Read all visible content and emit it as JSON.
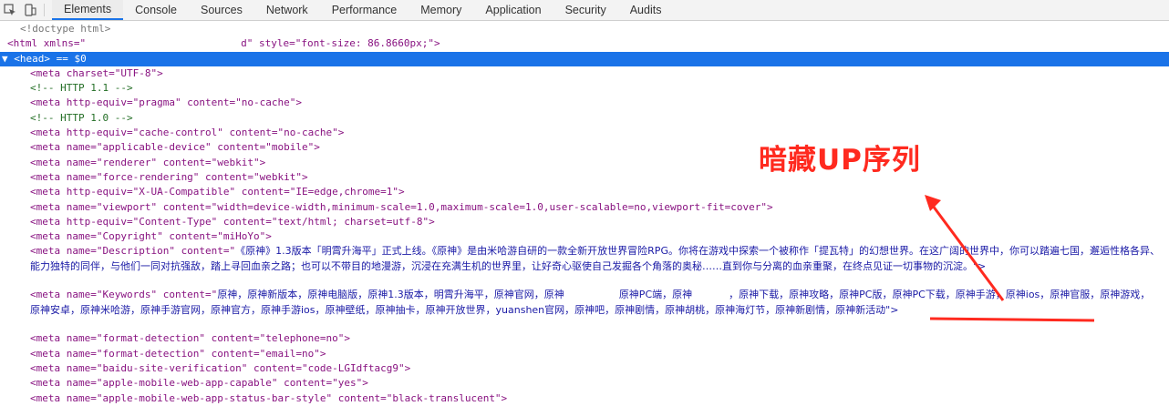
{
  "toolbar": {
    "icons": [
      "inspect-icon",
      "device-toolbar-icon"
    ],
    "tabs": [
      {
        "label": "Elements",
        "active": true
      },
      {
        "label": "Console"
      },
      {
        "label": "Sources"
      },
      {
        "label": "Network"
      },
      {
        "label": "Performance"
      },
      {
        "label": "Memory"
      },
      {
        "label": "Application"
      },
      {
        "label": "Security"
      },
      {
        "label": "Audits"
      }
    ]
  },
  "code": {
    "doctype": "<!doctype html>",
    "html_open_start": "<html xmlns=\"",
    "html_open_end": "d\" style=\"font-size: 86.8660px;\">",
    "head_line": "▼ <head> == $0",
    "meta_charset": "<meta charset=\"UTF-8\">",
    "comment_http11": "<!-- HTTP 1.1 -->",
    "meta_pragma": "<meta http-equiv=\"pragma\" content=\"no-cache\">",
    "comment_http10": "<!-- HTTP 1.0 -->",
    "meta_cache_control": "<meta http-equiv=\"cache-control\" content=\"no-cache\">",
    "meta_applicable_device": "<meta name=\"applicable-device\" content=\"mobile\">",
    "meta_renderer": "<meta name=\"renderer\" content=\"webkit\">",
    "meta_force_rendering": "<meta name=\"force-rendering\" content=\"webkit\">",
    "meta_ua_compatible": "<meta http-equiv=\"X-UA-Compatible\" content=\"IE=edge,chrome=1\">",
    "meta_viewport": "<meta name=\"viewport\" content=\"width=device-width,minimum-scale=1.0,maximum-scale=1.0,user-scalable=no,viewport-fit=cover\">",
    "meta_content_type": "<meta http-equiv=\"Content-Type\" content=\"text/html; charset=utf-8\">",
    "meta_copyright": "<meta name=\"Copyright\" content=\"miHoYo\">",
    "meta_description_prefix": "<meta name=\"Description\" content=\"",
    "meta_description_text": "《原神》1.3版本「明霄升海平」正式上线。《原神》是由米哈游自研的一款全新开放世界冒险RPG。你将在游戏中探索一个被称作「提瓦特」的幻想世界。在这广阔的世界中，你可以踏遍七国，邂逅性格各异、能力独特的同伴，与他们一同对抗强敌，踏上寻回血亲之路；也可以不带目的地漫游，沉浸在充满生机的世界里，让好奇心驱使自己发掘各个角落的奥秘……直到你与分离的血亲重聚，在终点见证一切事物的沉淀。\">",
    "meta_keywords_prefix": "<meta name=\"Keywords\" content=\"",
    "meta_keywords_text_1": "原神，原神新版本，原神电脑版，原神1.3版本，明霄升海平，原神官网，原神",
    "meta_keywords_text_2": "原神PC端，原神",
    "meta_keywords_text_3": "，原神下载，原神攻略，原神PC版，原神PC下载，原神手游，原神ios，原神官服，原神游戏，原神安卓，原神米哈游，原神手游官网，原神官方，原神手游ios，原神壁纸，原神抽卡，原神开放世界，yuanshen官网，原神吧，原神剧情，原神胡桃，原神海灯节，原神新剧情，原神新活动\">",
    "meta_format_telephone": "<meta name=\"format-detection\" content=\"telephone=no\">",
    "meta_format_email": "<meta name=\"format-detection\" content=\"email=no\">",
    "meta_baidu": "<meta name=\"baidu-site-verification\" content=\"code-LGIdftacg9\">",
    "meta_web_app": "<meta name=\"apple-mobile-web-app-capable\" content=\"yes\">",
    "meta_status_bar": "<meta name=\"apple-mobile-web-app-status-bar-style\" content=\"black-translucent\">"
  },
  "annotation": {
    "text": "暗藏UP序列",
    "color": "#ff2a1f"
  }
}
